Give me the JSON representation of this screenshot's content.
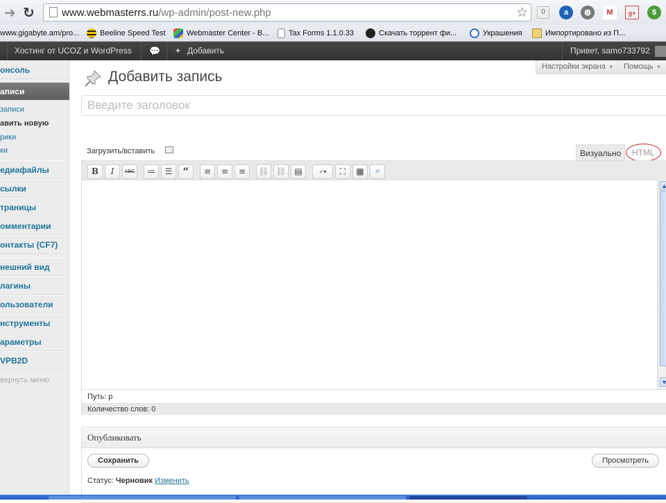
{
  "browser": {
    "url_host": "www.webmasterrs.ru",
    "url_path": "/wp-admin/post-new.php",
    "ext_badge": "0",
    "bookmarks": [
      {
        "label": "www.gigabyte.am/pro...",
        "icon": "gigabyte-icon"
      },
      {
        "label": "Beeline Speed Test",
        "icon": "beeline-icon"
      },
      {
        "label": "Webmaster Center - B...",
        "icon": "windows-icon"
      },
      {
        "label": "Tax Forms 1.1.0.33",
        "icon": "page-icon"
      },
      {
        "label": "Скачать торрент фи...",
        "icon": "hd-icon"
      },
      {
        "label": "Украшения",
        "icon": "ukrashenia-icon"
      },
      {
        "label": "Импортировано из П...",
        "icon": "folder-icon"
      }
    ]
  },
  "adminbar": {
    "site_name": "Хостинг от UCOZ и WordPress",
    "add_new": "Добавить",
    "greeting": "Привет, samo733792"
  },
  "sidebar": {
    "items": [
      {
        "label": "онсоль"
      },
      {
        "label": "аписи"
      },
      {
        "label": "едиафайлы"
      },
      {
        "label": "сылки"
      },
      {
        "label": "траницы"
      },
      {
        "label": "омментарии"
      },
      {
        "label": "онтакты (CF7)"
      },
      {
        "label": "нешний вид"
      },
      {
        "label": "лагины"
      },
      {
        "label": "ользователи"
      },
      {
        "label": "нструменты"
      },
      {
        "label": "араметры"
      },
      {
        "label": "VPB2D"
      }
    ],
    "submenu": [
      {
        "label": "записи"
      },
      {
        "label": "авить новую"
      },
      {
        "label": "рики"
      },
      {
        "label": "ки"
      }
    ],
    "collapse": "вернуть меню"
  },
  "main": {
    "screen_options": "Настройки экрана",
    "help": "Помощь",
    "page_title": "Добавить запись",
    "title_placeholder": "Введите заголовок",
    "upload_label": "Загрузить/вставить",
    "tab_visual": "Визуально",
    "tab_html": "HTML",
    "toolbar_labels": {
      "bold": "B",
      "italic": "I",
      "strike": "ABC"
    },
    "path_label": "Путь: p",
    "word_count": "Количество слов: 0"
  },
  "publish": {
    "heading": "Опубликовать",
    "save_button": "Сохранить",
    "preview_button": "Просмотреть",
    "status_label": "Статус:",
    "status_value": "Черновик",
    "status_edit": "Изменить"
  },
  "colors": {
    "link": "#21759b",
    "adminbar": "#464646",
    "current_menu": "#6d6d6d",
    "html_tab_highlight": "#cc2222"
  }
}
